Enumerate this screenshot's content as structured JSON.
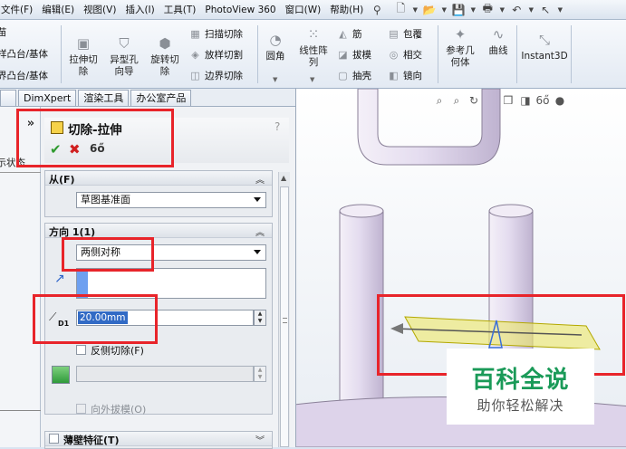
{
  "menu": {
    "items": [
      "文件(F)",
      "编辑(E)",
      "视图(V)",
      "插入(I)",
      "工具(T)",
      "PhotoView 360",
      "窗口(W)",
      "帮助(H)"
    ]
  },
  "ribbon": {
    "left_partial": [
      "苗",
      "样凸台/基体",
      "界凸台/基体"
    ],
    "stretch_cut": "拉伸切\n除",
    "hole_wizard": "异型孔\n向导",
    "revolve_cut": "旋转切\n除",
    "sweep_cut": "扫描切除",
    "loft_cut": "放样切割",
    "boundary_cut": "边界切除",
    "fillet": "圆角",
    "linear_pattern": "线性阵\n列",
    "rib": "筋",
    "draft": "拔模",
    "shell": "抽壳",
    "wrap": "包覆",
    "intersect": "相交",
    "mirror": "镜向",
    "ref_geometry": "参考几\n何体",
    "curves": "曲线",
    "instant3d": "Instant3D"
  },
  "tabs": [
    "DimXpert",
    "渲染工具",
    "办公室产品"
  ],
  "strip": {
    "collapse": "»",
    "partial_text": "显示状态"
  },
  "pm": {
    "title": "切除-拉伸",
    "help": "?",
    "from_label": "从(F)",
    "from_value": "草图基准面",
    "dir1_label": "方向 1(1)",
    "end_condition": "两侧对称",
    "depth_label": "D1",
    "depth_value": "20.00mm",
    "flip_cut": "反侧切除(F)",
    "draft_outward": "向外拔模(O)",
    "thin_feature": "薄壁特征(T)"
  },
  "watermark": {
    "title": "百科全说",
    "subtitle": "助你轻松解决"
  },
  "colors": {
    "highlight_box": "#e8242a",
    "preview_body": "#ece873",
    "model_purple": "#ddd3ea",
    "watermark_green": "#1a9a58"
  }
}
